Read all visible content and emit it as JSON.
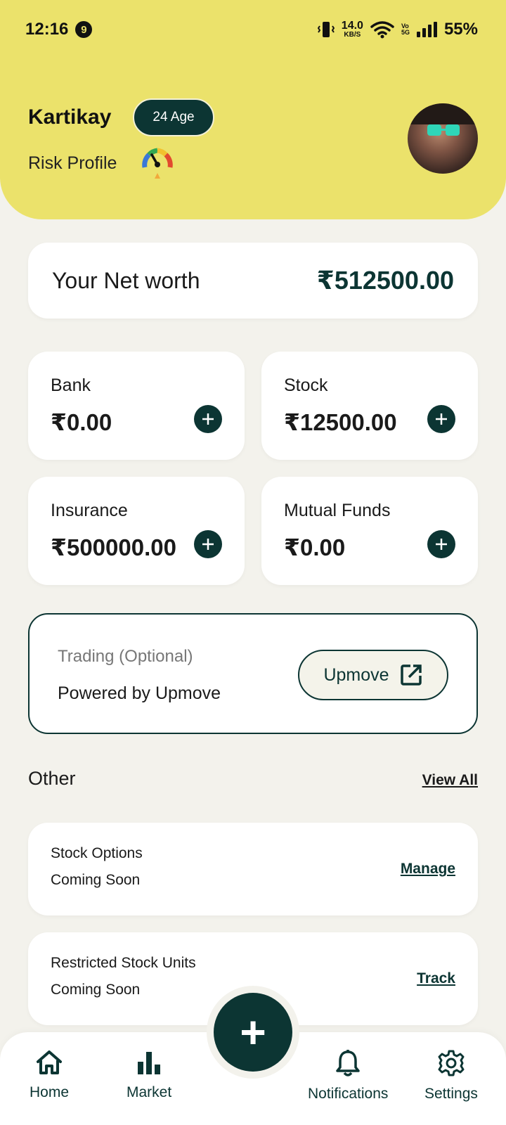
{
  "status_bar": {
    "time": "12:16",
    "notification_count": "9",
    "net_speed_value": "14.0",
    "net_speed_unit": "KB/S",
    "volte_top": "Vo",
    "volte_bottom": "5G",
    "battery": "55%"
  },
  "profile": {
    "name": "Kartikay",
    "age_badge": "24 Age",
    "risk_label": "Risk Profile"
  },
  "net_worth": {
    "label": "Your Net worth",
    "value": "₹512500.00"
  },
  "assets": [
    {
      "label": "Bank",
      "value": "₹0.00"
    },
    {
      "label": "Stock",
      "value": "₹12500.00"
    },
    {
      "label": "Insurance",
      "value": "₹500000.00"
    },
    {
      "label": "Mutual Funds",
      "value": "₹0.00"
    }
  ],
  "trading": {
    "label": "Trading (Optional)",
    "powered_by": "Powered by Upmove",
    "button_label": "Upmove"
  },
  "other": {
    "title": "Other",
    "view_all": "View All",
    "items": [
      {
        "title": "Stock Options",
        "subtitle": "Coming Soon",
        "action": "Manage"
      },
      {
        "title": "Restricted Stock Units",
        "subtitle": "Coming Soon",
        "action": "Track"
      }
    ]
  },
  "fab_symbol": "+",
  "nav": {
    "items": [
      {
        "label": "Home",
        "icon": "home-icon"
      },
      {
        "label": "Market",
        "icon": "bar-chart-icon"
      },
      {
        "label": "Notifications",
        "icon": "bell-icon"
      },
      {
        "label": "Settings",
        "icon": "gear-icon"
      }
    ]
  },
  "colors": {
    "header_bg": "#ebe26b",
    "accent": "#0c3533",
    "page_bg": "#f3f2ec"
  }
}
